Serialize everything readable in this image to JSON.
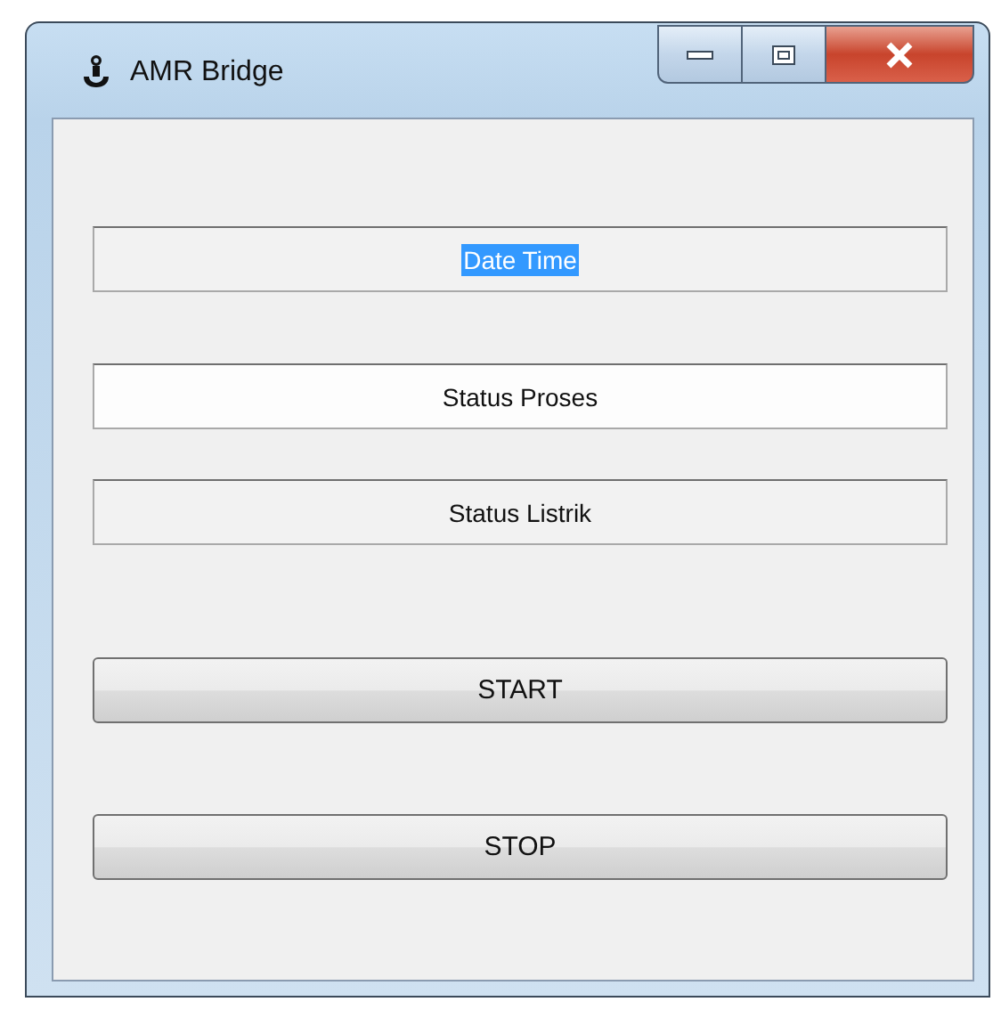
{
  "window": {
    "title": "AMR Bridge"
  },
  "fields": [
    {
      "value": "Date Time",
      "selected": true
    },
    {
      "value": "Status Proses",
      "selected": false
    },
    {
      "value": "Status Listrik",
      "selected": false
    }
  ],
  "buttons": [
    "START",
    "STOP"
  ]
}
